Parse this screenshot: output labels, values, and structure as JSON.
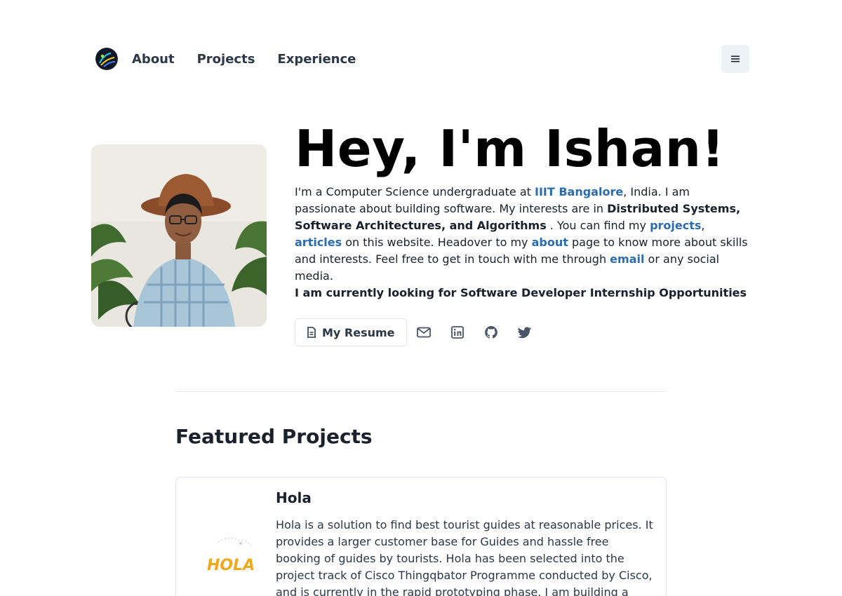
{
  "nav": {
    "links": [
      "About",
      "Projects",
      "Experience"
    ],
    "menu_icon": "hamburger-icon",
    "logo_icon": "avatar-logo"
  },
  "hero": {
    "title": "Hey, I'm Ishan!",
    "bio": {
      "p1": "I'm a Computer Science undergraduate at ",
      "link_iiit": "IIIT Bangalore",
      "p2": ", India. I am passionate about building software. My interests are in ",
      "interests": "Distributed Systems, Software Architectures, and Algorithms",
      "p3": " . You can find my ",
      "link_projects": "projects",
      "p4": ", ",
      "link_articles": "articles",
      "p5": " on this website. Headover to my ",
      "link_about": "about",
      "p6": " page to know more about skills and interests. Feel free to get in touch with me through ",
      "link_email": "email",
      "p7": " or any social media."
    },
    "looking_for": "I am currently looking for Software Developer Internship Opportunities",
    "resume_label": "My Resume",
    "social_icons": [
      "mail-icon",
      "linkedin-icon",
      "github-icon",
      "twitter-icon"
    ]
  },
  "featured": {
    "title": "Featured Projects",
    "projects": [
      {
        "name": "Hola",
        "logo_text": "HOLA",
        "description": "Hola is a solution to find best tourist guides at reasonable prices. It provides a larger customer base for Guides and hassle free booking of guides by tourists. Hola has been selected into the project track of Cisco Thingqbator Programme conducted by Cisco, and is currently in the rapid prototyping phase. I am building a"
      }
    ]
  },
  "colors": {
    "link": "#2b6cb0",
    "menu_bg": "#edf2f7",
    "border": "#e2e8f0",
    "hola_orange": "#f2a81d"
  }
}
